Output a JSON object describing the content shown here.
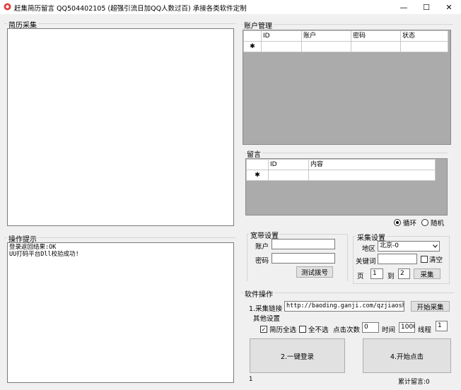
{
  "window": {
    "title": "赶集简历留言 QQ504402105 (超强引流日加QQ人数过百) 承接各类软件定制",
    "controls": {
      "minimize": "—",
      "maximize": "☐",
      "close": "✕"
    }
  },
  "resume": {
    "label": "简历采集"
  },
  "ops": {
    "label": "操作提示",
    "log": [
      "登录返回结果:OK",
      "UU打码平台Dll校验成功!"
    ]
  },
  "accounts": {
    "label": "账户管理",
    "columns": [
      "ID",
      "账户",
      "密码",
      "状态"
    ],
    "new_row_marker": "✱"
  },
  "messages": {
    "label": "留言",
    "columns": [
      "ID",
      "内容"
    ],
    "new_row_marker": "✱",
    "mode_options": [
      {
        "label": "循环",
        "selected": true
      },
      {
        "label": "随机",
        "selected": false
      }
    ]
  },
  "broadband": {
    "label": "宽带设置",
    "account_label": "账户",
    "password_label": "密码",
    "test_button": "测试拨号"
  },
  "collect": {
    "label": "采集设置",
    "region_label": "地区",
    "region_value": "北京-0",
    "keyword_label": "关键词",
    "clear_label": "清空",
    "page_label": "页",
    "page_from": "1",
    "to_label": "到",
    "page_to": "2",
    "collect_button": "采集"
  },
  "software": {
    "label": "软件操作",
    "link_label": "1.采集链接",
    "link_value": "http://baoding.ganji.com/qzjiaoshi/",
    "start_collect_button": "开始采集",
    "other_label": "其他设置",
    "select_all_label": "简历全选",
    "select_all_checked": true,
    "deselect_label": "全不选",
    "click_count_label": "点击次数",
    "click_count_value": "0",
    "interval_label": "时间",
    "interval_value": "1000",
    "thread_label": "线程",
    "thread_value": "1",
    "login_button": "2.一键登录",
    "click_button": "4.开始点击"
  },
  "status": {
    "left_value": "1",
    "total_label": "累计留言:0"
  }
}
